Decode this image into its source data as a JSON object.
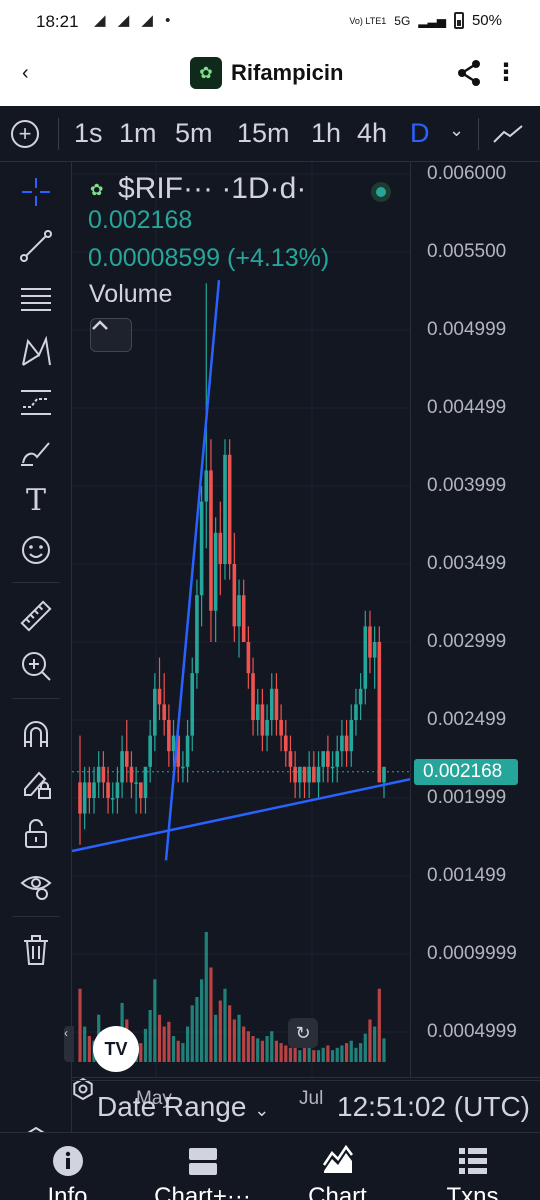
{
  "status_bar": {
    "time": "18:21",
    "notifications": "◢ ◢ ◢ •",
    "network": "Vo) LTE1",
    "signal": "5G",
    "battery": "50%"
  },
  "titlebar": {
    "back_icon": "chevron-left-icon",
    "title": "Rifampicin",
    "share_icon": "share-icon",
    "more_icon": "more-vertical-icon"
  },
  "toolbar": {
    "timeframes": [
      "1s",
      "1m",
      "5m",
      "15m",
      "1h",
      "4h",
      "D"
    ],
    "active_timeframe": "D",
    "accent": "#2962ff"
  },
  "draw_tools": [
    "crosshair-icon",
    "trendline-icon",
    "fib-icon",
    "pattern-icon",
    "prediction-icon",
    "brush-icon",
    "text-icon",
    "emoji-icon",
    "ruler-icon",
    "zoom-in-icon",
    "magnet-icon",
    "lock-draw-icon",
    "unlock-icon",
    "eye-icon",
    "trash-icon"
  ],
  "legend": {
    "symbol": "$RIF··· ·1D·d·",
    "price": "0.002168",
    "change": "0.00008599 (+4.13%)",
    "volume_label": "Volume"
  },
  "chart_data": {
    "type": "candlestick",
    "interval": "1D",
    "y_ticks": [
      "0.006000",
      "0.005500",
      "0.004999",
      "0.004499",
      "0.003999",
      "0.003499",
      "0.002999",
      "0.002499",
      "0.001999",
      "0.001499",
      "0.0009999",
      "0.0004999"
    ],
    "last_price": "0.002168",
    "x_ticks": [
      "May",
      "Jul"
    ],
    "ylim": [
      0.0004,
      0.006
    ],
    "up_color": "#26a69a",
    "down_color": "#ef5350",
    "trendline_color": "#2962ff",
    "candles": [
      [
        0.0021,
        0.0024,
        0.0017,
        0.0019
      ],
      [
        0.0019,
        0.0022,
        0.0018,
        0.0021
      ],
      [
        0.0021,
        0.0022,
        0.0019,
        0.002
      ],
      [
        0.002,
        0.0022,
        0.0019,
        0.0021
      ],
      [
        0.0021,
        0.0023,
        0.002,
        0.0022
      ],
      [
        0.0022,
        0.0023,
        0.002,
        0.0021
      ],
      [
        0.0021,
        0.0022,
        0.0019,
        0.002
      ],
      [
        0.002,
        0.0021,
        0.0019,
        0.002
      ],
      [
        0.002,
        0.0022,
        0.0019,
        0.0021
      ],
      [
        0.0021,
        0.0024,
        0.002,
        0.0023
      ],
      [
        0.0023,
        0.0025,
        0.0021,
        0.0022
      ],
      [
        0.0022,
        0.0023,
        0.002,
        0.0021
      ],
      [
        0.0021,
        0.0022,
        0.0019,
        0.0021
      ],
      [
        0.0021,
        0.0021,
        0.0019,
        0.002
      ],
      [
        0.002,
        0.0022,
        0.0019,
        0.0022
      ],
      [
        0.0022,
        0.0025,
        0.0021,
        0.0024
      ],
      [
        0.0024,
        0.0028,
        0.0023,
        0.0027
      ],
      [
        0.0027,
        0.0029,
        0.0025,
        0.0026
      ],
      [
        0.0026,
        0.0028,
        0.0024,
        0.0025
      ],
      [
        0.0025,
        0.0026,
        0.0022,
        0.0023
      ],
      [
        0.0023,
        0.0025,
        0.0022,
        0.0024
      ],
      [
        0.0024,
        0.0025,
        0.0021,
        0.0022
      ],
      [
        0.0022,
        0.0023,
        0.0021,
        0.0022
      ],
      [
        0.0022,
        0.0025,
        0.0021,
        0.0024
      ],
      [
        0.0024,
        0.0029,
        0.0023,
        0.0028
      ],
      [
        0.0028,
        0.0034,
        0.0027,
        0.0033
      ],
      [
        0.0033,
        0.004,
        0.0031,
        0.0039
      ],
      [
        0.0039,
        0.0053,
        0.0036,
        0.0041
      ],
      [
        0.0041,
        0.0043,
        0.003,
        0.0032
      ],
      [
        0.0032,
        0.0038,
        0.003,
        0.0037
      ],
      [
        0.0037,
        0.0039,
        0.0033,
        0.0035
      ],
      [
        0.0035,
        0.0043,
        0.0034,
        0.0042
      ],
      [
        0.0042,
        0.0043,
        0.0034,
        0.0035
      ],
      [
        0.0035,
        0.0037,
        0.003,
        0.0031
      ],
      [
        0.0031,
        0.0034,
        0.0029,
        0.0033
      ],
      [
        0.0033,
        0.0034,
        0.003,
        0.003
      ],
      [
        0.003,
        0.0031,
        0.0027,
        0.0028
      ],
      [
        0.0028,
        0.0029,
        0.0024,
        0.0025
      ],
      [
        0.0025,
        0.0027,
        0.0024,
        0.0026
      ],
      [
        0.0026,
        0.0027,
        0.0023,
        0.0024
      ],
      [
        0.0024,
        0.0026,
        0.0023,
        0.0025
      ],
      [
        0.0025,
        0.0028,
        0.0024,
        0.0027
      ],
      [
        0.0027,
        0.0028,
        0.0024,
        0.0025
      ],
      [
        0.0025,
        0.0026,
        0.0023,
        0.0024
      ],
      [
        0.0024,
        0.0025,
        0.0022,
        0.0023
      ],
      [
        0.0023,
        0.0024,
        0.0021,
        0.0022
      ],
      [
        0.0022,
        0.0023,
        0.002,
        0.0021
      ],
      [
        0.0021,
        0.0022,
        0.002,
        0.0022
      ],
      [
        0.0022,
        0.0022,
        0.002,
        0.0021
      ],
      [
        0.0021,
        0.0023,
        0.002,
        0.0022
      ],
      [
        0.0022,
        0.0023,
        0.0021,
        0.0021
      ],
      [
        0.0021,
        0.0023,
        0.002,
        0.0022
      ],
      [
        0.0022,
        0.0023,
        0.0021,
        0.0023
      ],
      [
        0.0023,
        0.0024,
        0.0021,
        0.0022
      ],
      [
        0.0022,
        0.0023,
        0.0021,
        0.0022
      ],
      [
        0.0022,
        0.0024,
        0.0021,
        0.0023
      ],
      [
        0.0023,
        0.0025,
        0.0022,
        0.0024
      ],
      [
        0.0024,
        0.0025,
        0.0022,
        0.0023
      ],
      [
        0.0023,
        0.0026,
        0.0022,
        0.0025
      ],
      [
        0.0025,
        0.0027,
        0.0024,
        0.0026
      ],
      [
        0.0026,
        0.0028,
        0.0025,
        0.0027
      ],
      [
        0.0027,
        0.0032,
        0.0026,
        0.0031
      ],
      [
        0.0031,
        0.0032,
        0.0028,
        0.0029
      ],
      [
        0.0029,
        0.0031,
        0.0027,
        0.003
      ],
      [
        0.003,
        0.0031,
        0.0021,
        0.0021
      ],
      [
        0.0021,
        0.0022,
        0.002,
        0.0022
      ]
    ],
    "volumes": [
      62,
      30,
      22,
      18,
      40,
      26,
      20,
      18,
      30,
      50,
      36,
      22,
      18,
      16,
      28,
      44,
      70,
      40,
      30,
      34,
      22,
      18,
      16,
      30,
      48,
      55,
      70,
      110,
      80,
      40,
      52,
      62,
      48,
      36,
      40,
      30,
      26,
      22,
      20,
      18,
      22,
      26,
      18,
      16,
      14,
      12,
      14,
      10,
      12,
      14,
      10,
      10,
      12,
      14,
      10,
      12,
      14,
      16,
      18,
      12,
      16,
      24,
      36,
      30,
      62,
      20
    ]
  },
  "axis_extra": {
    "settings_icon": "gear-icon",
    "collapse_icon": "chevron-up-icon",
    "reset_icon": "reset-icon",
    "tv_logo": "TV"
  },
  "date_bar": {
    "date_range": "Date Range",
    "chevron_icon": "chevron-down-icon",
    "time": "12:51:02 (UTC)"
  },
  "bottom_nav": [
    {
      "label": "Info",
      "icon": "info-icon"
    },
    {
      "label": "Chart+···",
      "icon": "chart-plus-icon"
    },
    {
      "label": "Chart",
      "icon": "chart-icon"
    },
    {
      "label": "Txns",
      "icon": "list-icon"
    }
  ]
}
